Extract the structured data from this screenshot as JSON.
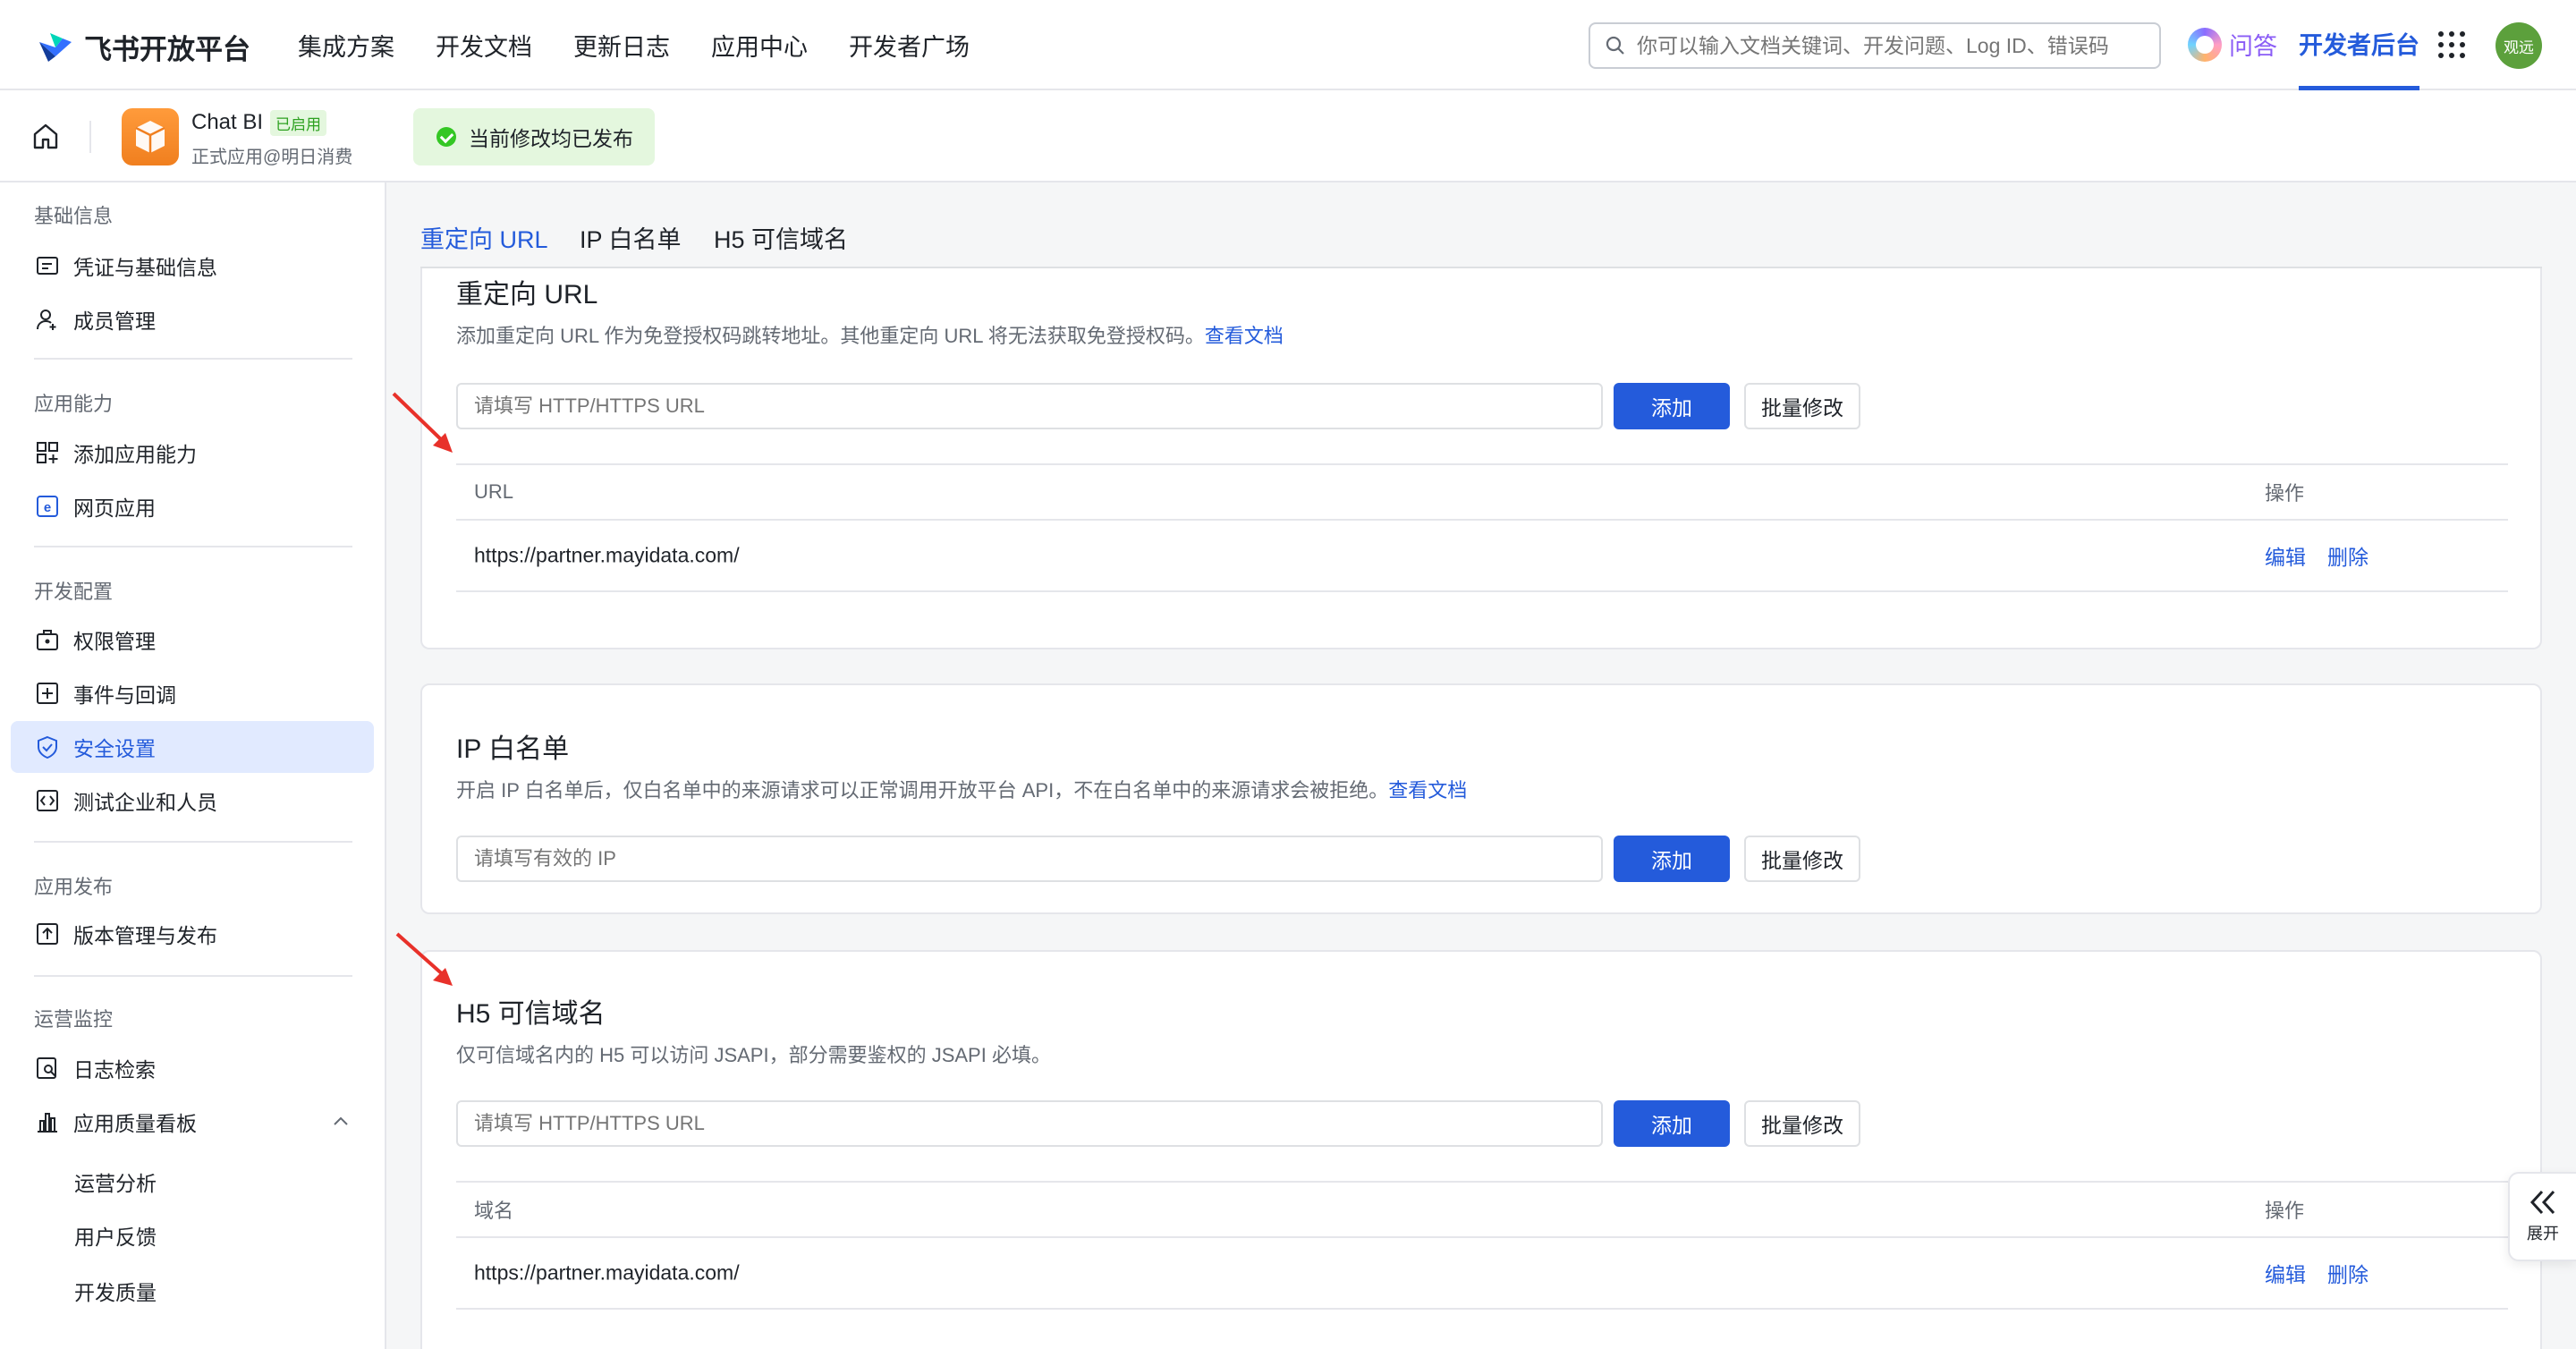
{
  "topnav": {
    "logo_text": "飞书开放平台",
    "links": [
      "集成方案",
      "开发文档",
      "更新日志",
      "应用中心",
      "开发者广场"
    ],
    "search_placeholder": "你可以输入文档关键词、开发问题、Log ID、错误码",
    "wenda": "问答",
    "dev_console": "开发者后台",
    "avatar_text": "观远"
  },
  "appbar": {
    "app_name": "Chat BI",
    "app_status": "已启用",
    "app_sub": "正式应用@明日消费",
    "publish_status": "当前修改均已发布"
  },
  "sidebar": {
    "groups": {
      "basic": "基础信息",
      "ability": "应用能力",
      "dev": "开发配置",
      "release": "应用发布",
      "ops": "运营监控"
    },
    "items": {
      "credentials": "凭证与基础信息",
      "members": "成员管理",
      "add_ability": "添加应用能力",
      "web_app": "网页应用",
      "permissions": "权限管理",
      "events": "事件与回调",
      "security": "安全设置",
      "test_org": "测试企业和人员",
      "version": "版本管理与发布",
      "logs": "日志检索",
      "quality": "应用质量看板"
    },
    "subitems": {
      "ops_analysis": "运营分析",
      "feedback": "用户反馈",
      "dev_quality": "开发质量"
    }
  },
  "tabs": [
    "重定向 URL",
    "IP 白名单",
    "H5 可信域名"
  ],
  "redirect": {
    "title": "重定向 URL",
    "desc": "添加重定向 URL 作为免登授权码跳转地址。其他重定向 URL 将无法获取免登授权码。",
    "doc_link": "查看文档",
    "placeholder": "请填写 HTTP/HTTPS URL",
    "add": "添加",
    "batch": "批量修改",
    "col_url": "URL",
    "col_op": "操作",
    "rows": [
      {
        "url": "https://partner.mayidata.com/",
        "edit": "编辑",
        "delete": "删除"
      }
    ]
  },
  "ip": {
    "title": "IP 白名单",
    "desc": "开启 IP 白名单后，仅白名单中的来源请求可以正常调用开放平台 API，不在白名单中的来源请求会被拒绝。",
    "doc_link": "查看文档",
    "placeholder": "请填写有效的 IP",
    "add": "添加",
    "batch": "批量修改"
  },
  "h5": {
    "title": "H5 可信域名",
    "desc": "仅可信域名内的 H5 可以访问 JSAPI，部分需要鉴权的 JSAPI 必填。",
    "placeholder": "请填写 HTTP/HTTPS URL",
    "add": "添加",
    "batch": "批量修改",
    "col_domain": "域名",
    "col_op": "操作",
    "rows": [
      {
        "domain": "https://partner.mayidata.com/",
        "edit": "编辑",
        "delete": "删除"
      }
    ]
  },
  "expand": "展开",
  "colors": {
    "accent": "#245bdb",
    "success": "#34c724",
    "arrow": "#e8312a"
  }
}
